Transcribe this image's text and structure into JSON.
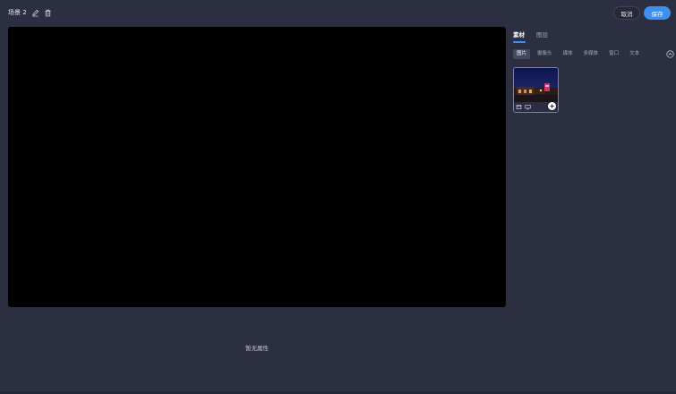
{
  "header": {
    "scene_name": "场景 2",
    "cancel_label": "取消",
    "save_label": "保存"
  },
  "canvas": {
    "empty_properties_text": "暂无属性"
  },
  "sidebar": {
    "tabs": [
      {
        "label": "素材",
        "active": true
      },
      {
        "label": "图层",
        "active": false
      }
    ],
    "categories": [
      {
        "label": "图片",
        "active": true
      },
      {
        "label": "摄像头",
        "active": false
      },
      {
        "label": "媒体",
        "active": false
      },
      {
        "label": "多媒体",
        "active": false
      },
      {
        "label": "窗口",
        "active": false
      },
      {
        "label": "文本",
        "active": false
      }
    ]
  },
  "colors": {
    "background": "#2c2e42",
    "accent": "#3d8ff0",
    "canvas": "#000000"
  }
}
